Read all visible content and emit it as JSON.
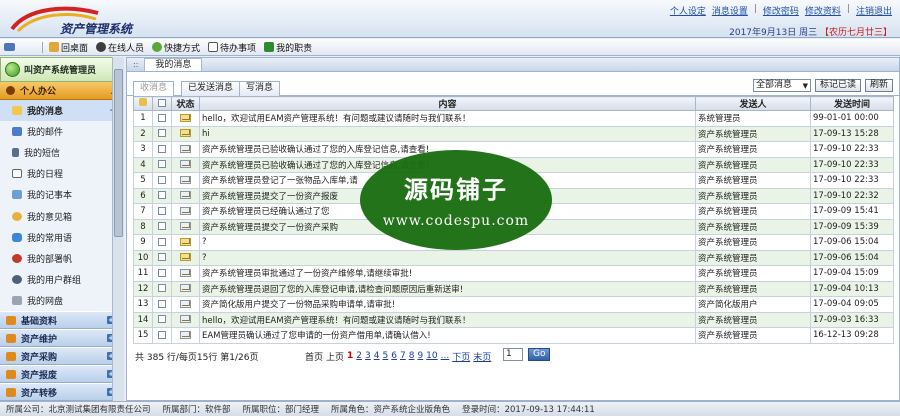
{
  "app": {
    "title": "资产管理系统"
  },
  "top_links": [
    "个人设定",
    "消息设置",
    "修改密码",
    "修改资料",
    "注销退出"
  ],
  "date": {
    "date": "2017年9月13日",
    "weekday": "周三",
    "lunar": "【农历七月廿三】"
  },
  "toolbar": [
    "回桌面",
    "在线人员",
    "快捷方式",
    "待办事项",
    "我的职责"
  ],
  "user": {
    "name": "叫资产系统管理员"
  },
  "sidebar": {
    "section": "个人办公",
    "items": [
      "我的消息",
      "我的邮件",
      "我的短信",
      "我的日程",
      "我的记事本",
      "我的意见箱",
      "我的常用语",
      "我的部署帆",
      "我的用户群组",
      "我的网盘"
    ],
    "groups": [
      "基础资料",
      "资产维护",
      "资产采购",
      "资产报废",
      "资产转移"
    ]
  },
  "panel": {
    "title": "我的消息"
  },
  "tabs": [
    "收消息",
    "已发送消息",
    "写消息"
  ],
  "filter": {
    "selected": "全部消息"
  },
  "buttons": {
    "mark_read": "标记已读",
    "refresh": "刷新"
  },
  "table": {
    "headers": [
      "状态",
      "内容",
      "发送人",
      "发送时间"
    ],
    "rows": [
      {
        "num": "1",
        "status": "unread",
        "content": "hello，欢迎试用EAM资产管理系统！有问题或建议请随时与我们联系！",
        "sender": "系统管理员",
        "time": "99-01-01 00:00"
      },
      {
        "num": "2",
        "status": "unread",
        "content": "hi",
        "sender": "资产系统管理员",
        "time": "17-09-13 15:28"
      },
      {
        "num": "3",
        "status": "read",
        "content": "资产系统管理员已验收确认通过了您的入库登记信息,请查看!",
        "sender": "资产系统管理员",
        "time": "17-09-10 22:33"
      },
      {
        "num": "4",
        "status": "read",
        "content": "资产系统管理员已验收确认通过了您的入库登记信息,请查看!",
        "sender": "资产系统管理员",
        "time": "17-09-10 22:33"
      },
      {
        "num": "5",
        "status": "read",
        "content": "资产系统管理员登记了一张物品入库单,请",
        "sender": "资产系统管理员",
        "time": "17-09-10 22:33"
      },
      {
        "num": "6",
        "status": "read",
        "content": "资产系统管理员提交了一份资产报废",
        "sender": "资产系统管理员",
        "time": "17-09-10 22:32"
      },
      {
        "num": "7",
        "status": "read",
        "content": "资产系统管理员已经确认通过了您",
        "sender": "资产系统管理员",
        "time": "17-09-09 15:41"
      },
      {
        "num": "8",
        "status": "read",
        "content": "资产系统管理员提交了一份资产采购",
        "sender": "资产系统管理员",
        "time": "17-09-09 15:39"
      },
      {
        "num": "9",
        "status": "unread",
        "content": "?",
        "sender": "资产系统管理员",
        "time": "17-09-06 15:04"
      },
      {
        "num": "10",
        "status": "unread",
        "content": "?",
        "sender": "资产系统管理员",
        "time": "17-09-06 15:04"
      },
      {
        "num": "11",
        "status": "read",
        "content": "资产系统管理员审批通过了一份资产维修单,请继续审批!",
        "sender": "资产系统管理员",
        "time": "17-09-04 15:09"
      },
      {
        "num": "12",
        "status": "read",
        "content": "资产系统管理员退回了您的入库登记申请,请检查问题原因后重新送审!",
        "sender": "资产系统管理员",
        "time": "17-09-04 10:13"
      },
      {
        "num": "13",
        "status": "read",
        "content": "资产简化版用户提交了一份物品采购申请单,请审批!",
        "sender": "资产简化版用户",
        "time": "17-09-04 09:05"
      },
      {
        "num": "14",
        "status": "read",
        "content": "hello，欢迎试用EAM资产管理系统！有问题或建议请随时与我们联系！",
        "sender": "资产系统管理员",
        "time": "17-09-03 16:33"
      },
      {
        "num": "15",
        "status": "read",
        "content": "EAM管理员确认通过了您申请的一份资产借用单,请确认借入!",
        "sender": "资产系统管理员",
        "time": "16-12-13 09:28"
      }
    ]
  },
  "pager": {
    "info": "共 385 行/每页15行 第1/26页",
    "first": "首页",
    "prev": "上页",
    "pages": [
      "1",
      "2",
      "3",
      "4",
      "5",
      "6",
      "7",
      "8",
      "9",
      "10",
      "..."
    ],
    "next": "下页",
    "last": "末页",
    "input": "1",
    "go": "Go"
  },
  "watermark": {
    "line1": "源码铺子",
    "line2": "www.codespu.com"
  },
  "footer": [
    "所属公司：北京测试集团有限责任公司",
    "所属部门：软件部",
    "所属职位：部门经理",
    "所属角色：资产系统企业版角色",
    "登录时间：2017-09-13 17:44:11"
  ],
  "colors": {
    "accent": "#e49b22",
    "header_blue": "#1f2f6e",
    "row_alt": "#e9f3e6"
  }
}
